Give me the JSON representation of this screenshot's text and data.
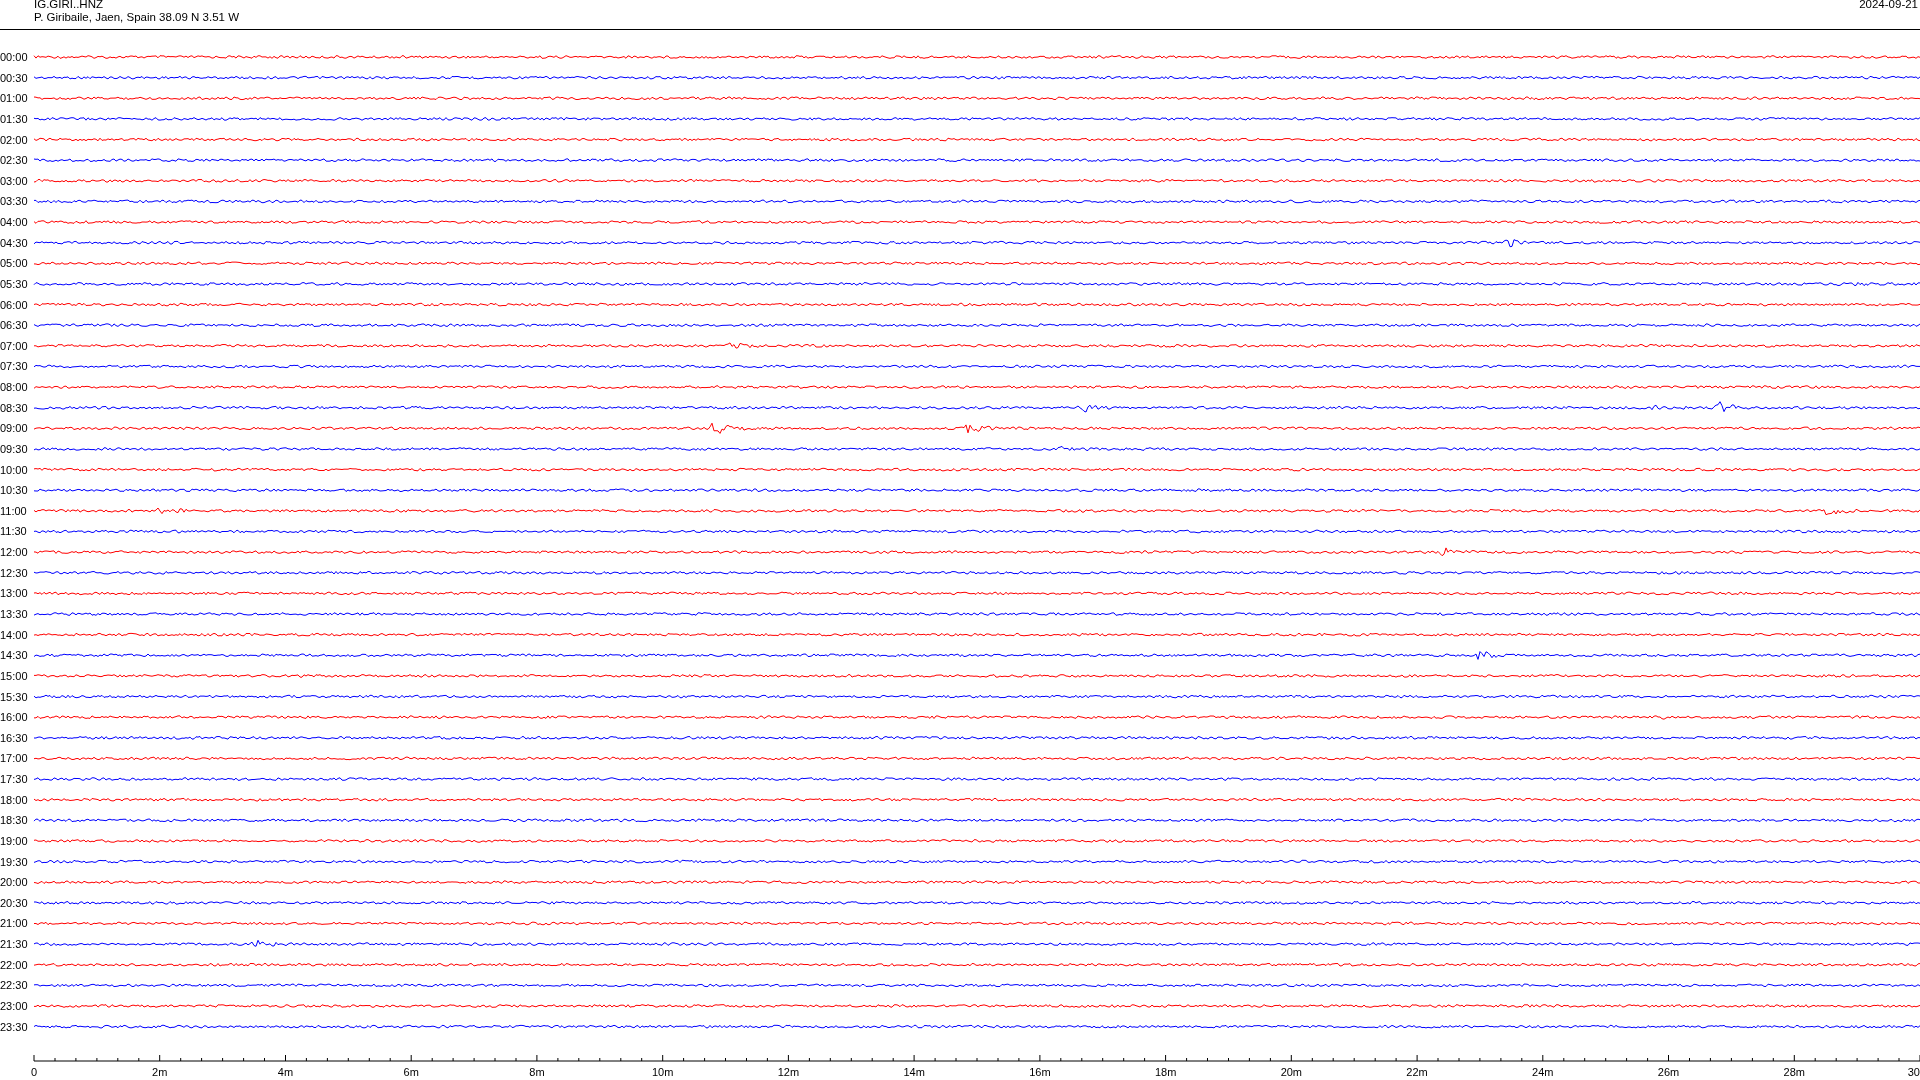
{
  "header": {
    "station": "IG.GIRI..HNZ",
    "location": "P. Giribaile, Jaen, Spain  38.09 N 3.51 W",
    "date": "2024-09-21"
  },
  "traces": [
    {
      "label": "00:00",
      "color": "#ff0000"
    },
    {
      "label": "00:30",
      "color": "#0000ff"
    },
    {
      "label": "01:00",
      "color": "#ff0000"
    },
    {
      "label": "01:30",
      "color": "#0000ff"
    },
    {
      "label": "02:00",
      "color": "#ff0000"
    },
    {
      "label": "02:30",
      "color": "#0000ff"
    },
    {
      "label": "03:00",
      "color": "#ff0000"
    },
    {
      "label": "03:30",
      "color": "#0000ff"
    },
    {
      "label": "04:00",
      "color": "#ff0000"
    },
    {
      "label": "04:30",
      "color": "#0000ff"
    },
    {
      "label": "05:00",
      "color": "#ff0000"
    },
    {
      "label": "05:30",
      "color": "#0000ff"
    },
    {
      "label": "06:00",
      "color": "#ff0000"
    },
    {
      "label": "06:30",
      "color": "#0000ff"
    },
    {
      "label": "07:00",
      "color": "#ff0000"
    },
    {
      "label": "07:30",
      "color": "#0000ff"
    },
    {
      "label": "08:00",
      "color": "#ff0000"
    },
    {
      "label": "08:30",
      "color": "#0000ff"
    },
    {
      "label": "09:00",
      "color": "#ff0000"
    },
    {
      "label": "09:30",
      "color": "#0000ff"
    },
    {
      "label": "10:00",
      "color": "#ff0000"
    },
    {
      "label": "10:30",
      "color": "#0000ff"
    },
    {
      "label": "11:00",
      "color": "#ff0000"
    },
    {
      "label": "11:30",
      "color": "#0000ff"
    },
    {
      "label": "12:00",
      "color": "#ff0000"
    },
    {
      "label": "12:30",
      "color": "#0000ff"
    },
    {
      "label": "13:00",
      "color": "#ff0000"
    },
    {
      "label": "13:30",
      "color": "#0000ff"
    },
    {
      "label": "14:00",
      "color": "#ff0000"
    },
    {
      "label": "14:30",
      "color": "#0000ff"
    },
    {
      "label": "15:00",
      "color": "#ff0000"
    },
    {
      "label": "15:30",
      "color": "#0000ff"
    },
    {
      "label": "16:00",
      "color": "#ff0000"
    },
    {
      "label": "16:30",
      "color": "#0000ff"
    },
    {
      "label": "17:00",
      "color": "#ff0000"
    },
    {
      "label": "17:30",
      "color": "#0000ff"
    },
    {
      "label": "18:00",
      "color": "#ff0000"
    },
    {
      "label": "18:30",
      "color": "#0000ff"
    },
    {
      "label": "19:00",
      "color": "#ff0000"
    },
    {
      "label": "19:30",
      "color": "#0000ff"
    },
    {
      "label": "20:00",
      "color": "#ff0000"
    },
    {
      "label": "20:30",
      "color": "#0000ff"
    },
    {
      "label": "21:00",
      "color": "#ff0000"
    },
    {
      "label": "21:30",
      "color": "#0000ff"
    },
    {
      "label": "22:00",
      "color": "#ff0000"
    },
    {
      "label": "22:30",
      "color": "#0000ff"
    },
    {
      "label": "23:00",
      "color": "#ff0000"
    },
    {
      "label": "23:30",
      "color": "#0000ff"
    }
  ],
  "axis_labels": [
    "0",
    "2m",
    "4m",
    "6m",
    "8m",
    "10m",
    "12m",
    "14m",
    "16m",
    "18m",
    "20m",
    "22m",
    "24m",
    "26m",
    "28m",
    "30"
  ]
}
